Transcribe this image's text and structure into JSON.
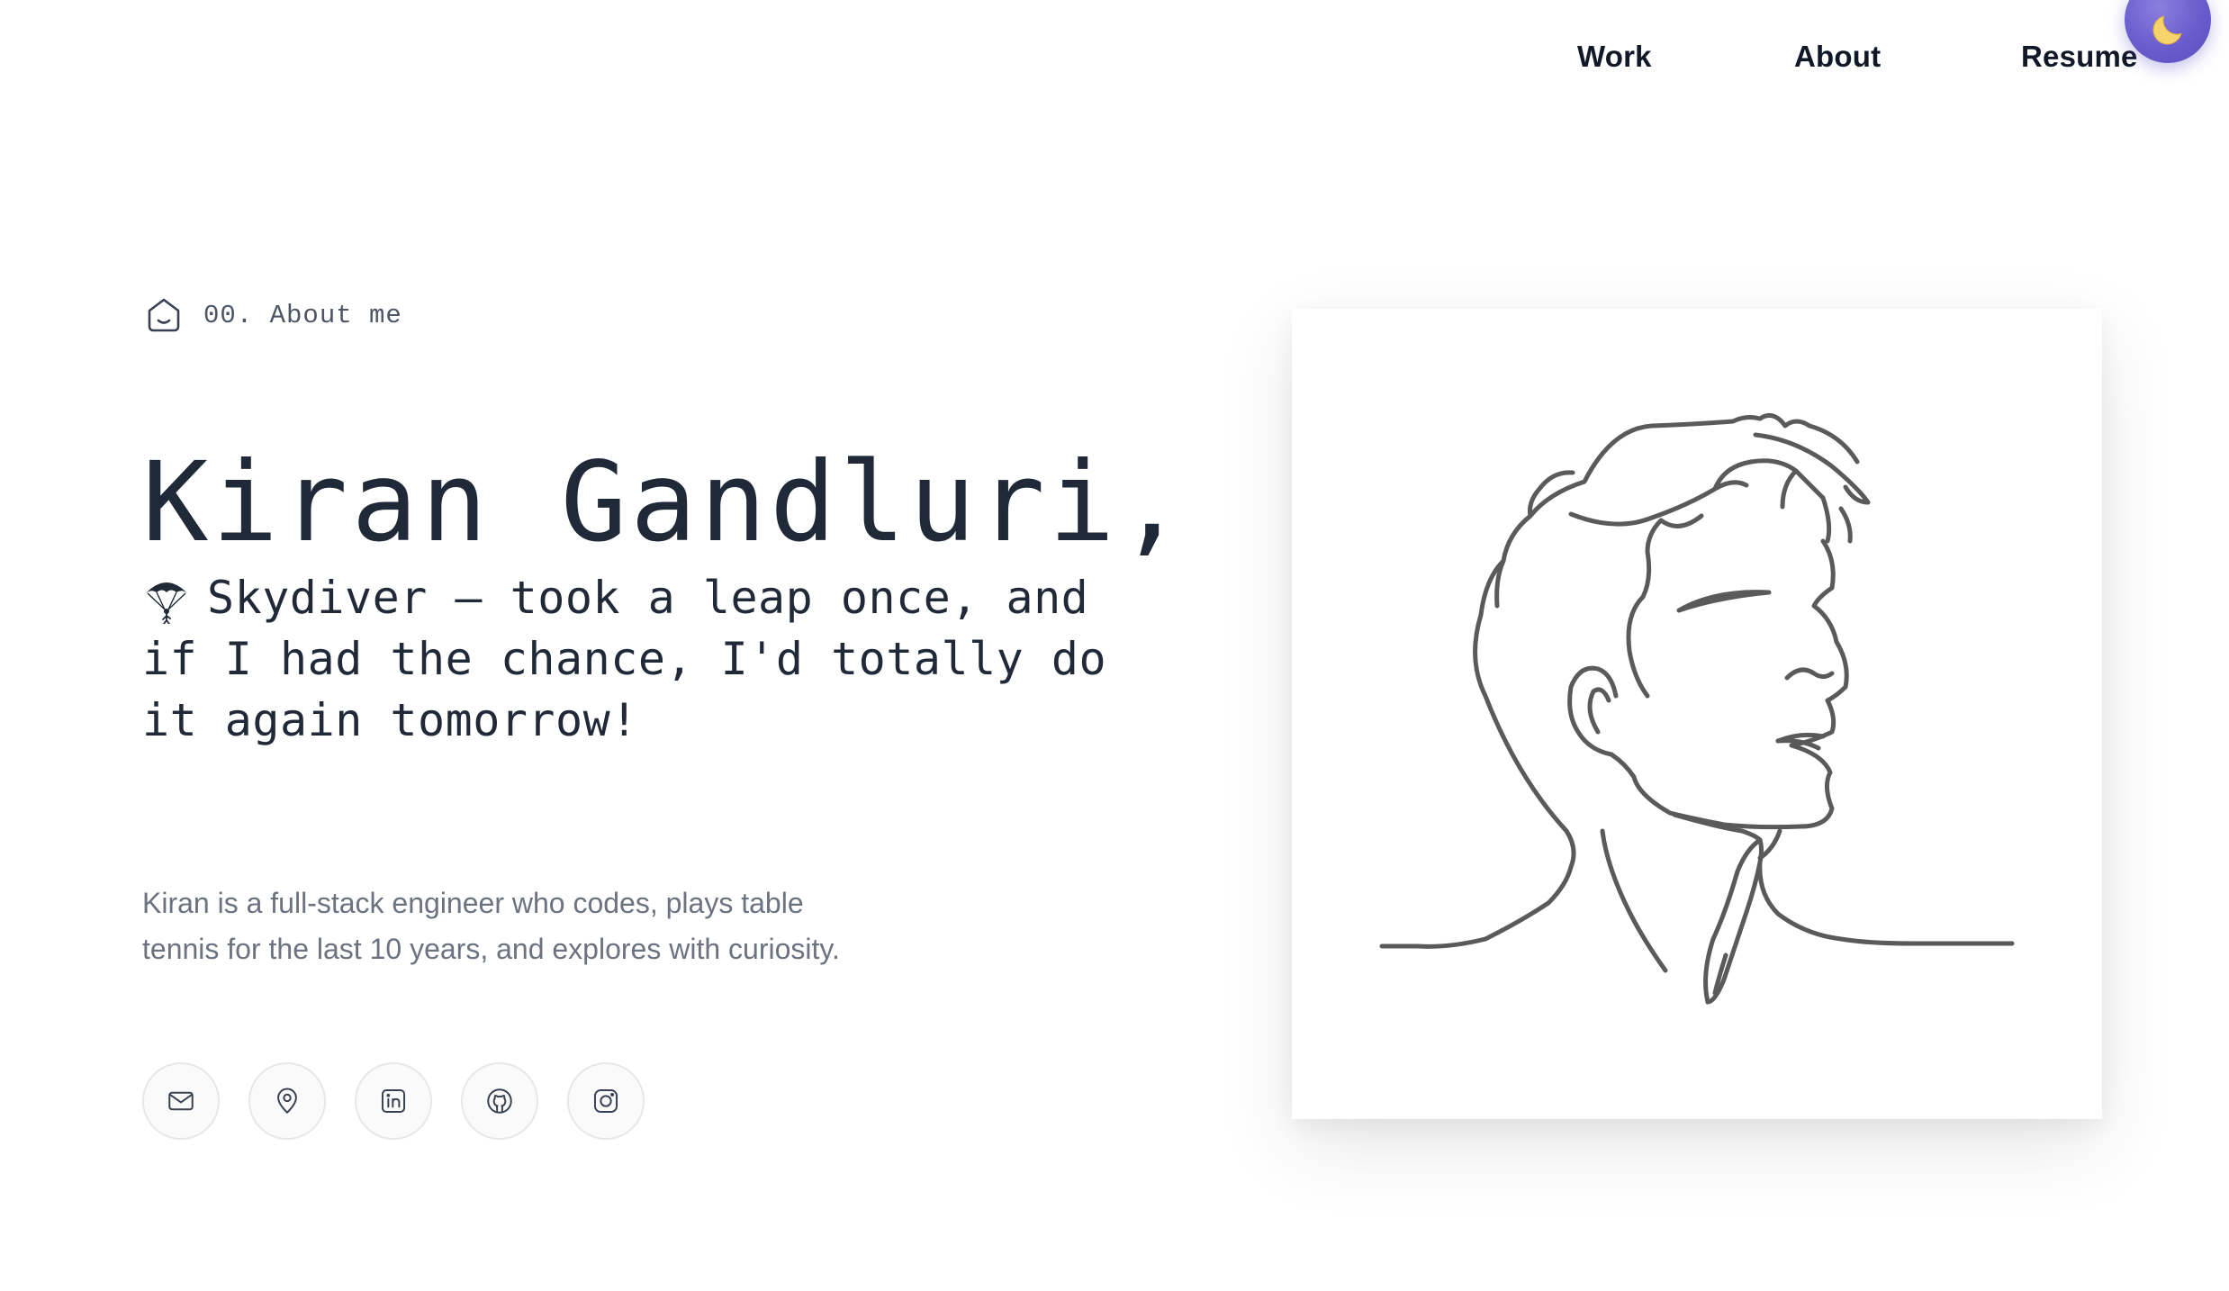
{
  "nav": {
    "links": [
      "Work",
      "About",
      "Resume"
    ],
    "theme_toggle_icon": "moon-icon"
  },
  "hero": {
    "section_label": "00. About me",
    "section_icon": "home-icon",
    "name": "Kiran Gandluri,",
    "tagline_icon": "parachute-icon",
    "tagline": "Skydiver — took a leap once, and if I had the chance, I'd totally do it again tomorrow!",
    "bio": "Kiran is a full-stack engineer who codes, plays table tennis for the last 10 years, and explores with curiosity."
  },
  "socials": [
    {
      "icon": "mail-icon"
    },
    {
      "icon": "location-pin-icon"
    },
    {
      "icon": "linkedin-icon"
    },
    {
      "icon": "github-icon"
    },
    {
      "icon": "instagram-icon"
    }
  ],
  "portrait": {
    "alt": "line-art-portrait"
  },
  "colors": {
    "accent": "#6a5ccc",
    "text_primary": "#1f2937",
    "text_muted": "#6b7280",
    "line_art": "#5a5a5a"
  }
}
